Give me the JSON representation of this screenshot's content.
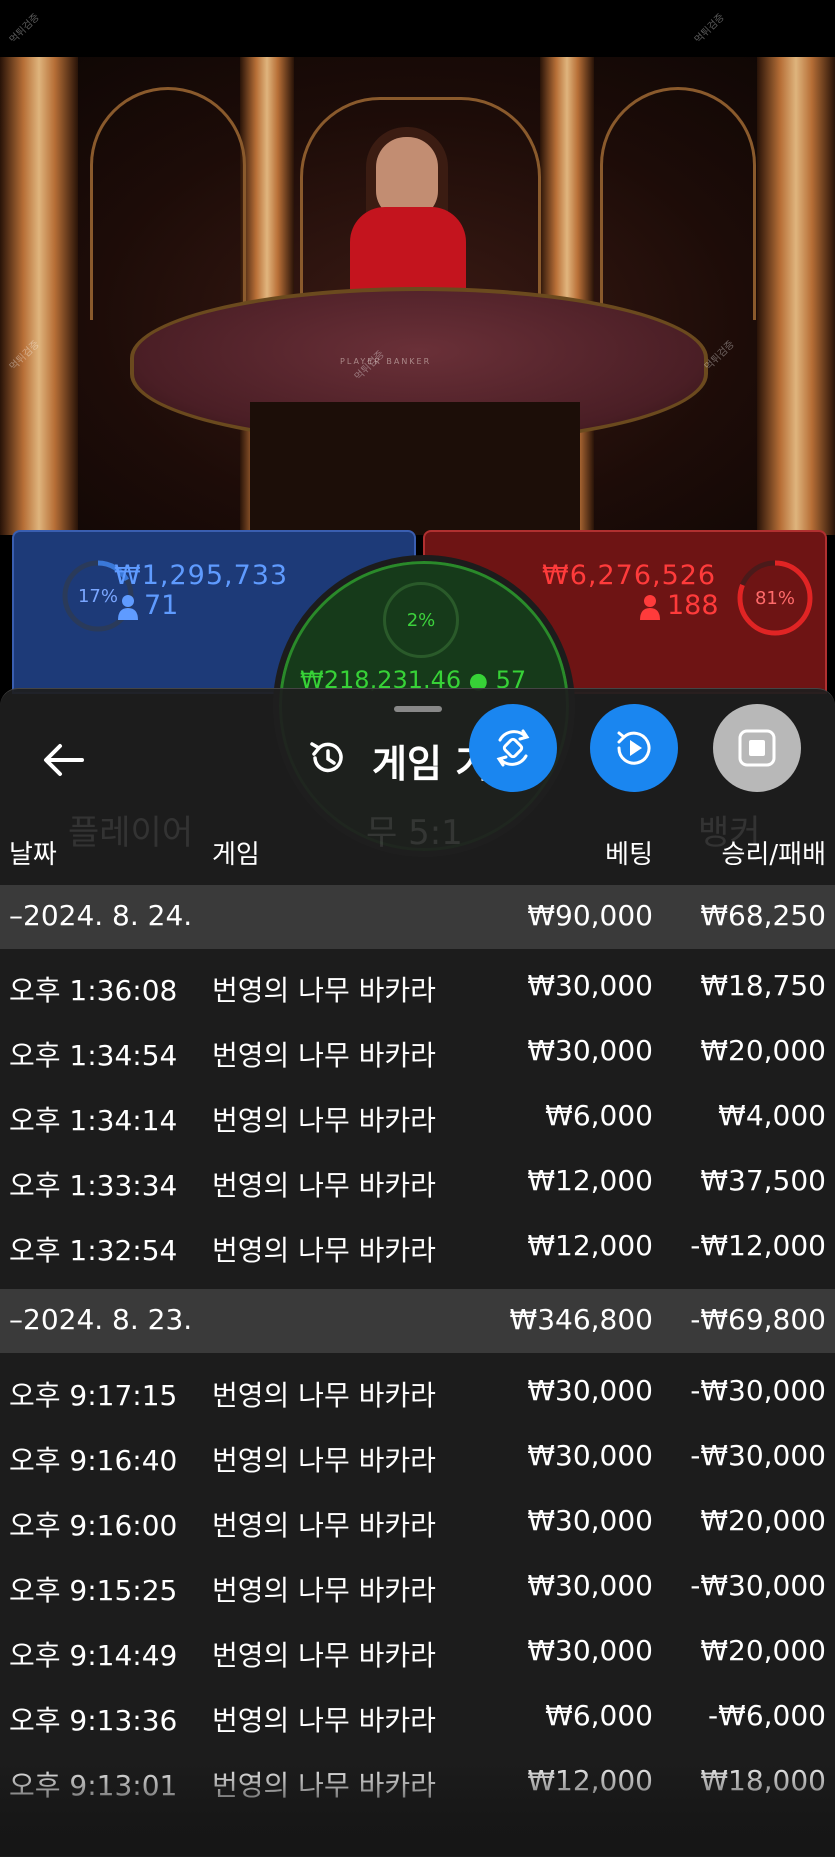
{
  "video": {
    "felt_label": "PLAYER    BANKER",
    "watermark": "먹튀검증"
  },
  "betting": {
    "player": {
      "percent": "17%",
      "amount": "₩1,295,733",
      "bettors": "71",
      "color": "#3a78d8"
    },
    "banker": {
      "percent": "81%",
      "amount": "₩6,276,526",
      "bettors": "188",
      "color": "#e02424"
    },
    "tie": {
      "percent": "2%",
      "amount": "₩218,231.46",
      "bettors": "57",
      "color": "#37d237"
    }
  },
  "sheet": {
    "back_icon": "arrow-left-icon",
    "history_icon": "history-icon",
    "title": "게임 기록",
    "fab_buttons": [
      {
        "icon": "rotate-icon",
        "color": "#1a86f0"
      },
      {
        "icon": "replay-icon",
        "color": "#1a86f0"
      },
      {
        "icon": "stop-icon",
        "color": "#b8b8b8"
      }
    ],
    "background_labels": {
      "player": "플레이어",
      "tie": "무 5:1",
      "banker": "뱅커"
    }
  },
  "table": {
    "headers": {
      "date": "날짜",
      "game": "게임",
      "bet": "베팅",
      "result": "승리/패배"
    },
    "groups": [
      {
        "date": "–2024. 8. 24.",
        "total_bet": "₩90,000",
        "total_result": "₩68,250",
        "rows": [
          {
            "time": "오후 1:36:08",
            "game": "번영의 나무 바카라",
            "bet": "₩30,000",
            "result": "₩18,750"
          },
          {
            "time": "오후 1:34:54",
            "game": "번영의 나무 바카라",
            "bet": "₩30,000",
            "result": "₩20,000"
          },
          {
            "time": "오후 1:34:14",
            "game": "번영의 나무 바카라",
            "bet": "₩6,000",
            "result": "₩4,000"
          },
          {
            "time": "오후 1:33:34",
            "game": "번영의 나무 바카라",
            "bet": "₩12,000",
            "result": "₩37,500"
          },
          {
            "time": "오후 1:32:54",
            "game": "번영의 나무 바카라",
            "bet": "₩12,000",
            "result": "-₩12,000"
          }
        ]
      },
      {
        "date": "–2024. 8. 23.",
        "total_bet": "₩346,800",
        "total_result": "-₩69,800",
        "rows": [
          {
            "time": "오후 9:17:15",
            "game": "번영의 나무 바카라",
            "bet": "₩30,000",
            "result": "-₩30,000"
          },
          {
            "time": "오후 9:16:40",
            "game": "번영의 나무 바카라",
            "bet": "₩30,000",
            "result": "-₩30,000"
          },
          {
            "time": "오후 9:16:00",
            "game": "번영의 나무 바카라",
            "bet": "₩30,000",
            "result": "₩20,000"
          },
          {
            "time": "오후 9:15:25",
            "game": "번영의 나무 바카라",
            "bet": "₩30,000",
            "result": "-₩30,000"
          },
          {
            "time": "오후 9:14:49",
            "game": "번영의 나무 바카라",
            "bet": "₩30,000",
            "result": "₩20,000"
          },
          {
            "time": "오후 9:13:36",
            "game": "번영의 나무 바카라",
            "bet": "₩6,000",
            "result": "-₩6,000"
          },
          {
            "time": "오후 9:13:01",
            "game": "번영의 나무 바카라",
            "bet": "₩12,000",
            "result": "₩18,000"
          }
        ]
      }
    ]
  }
}
